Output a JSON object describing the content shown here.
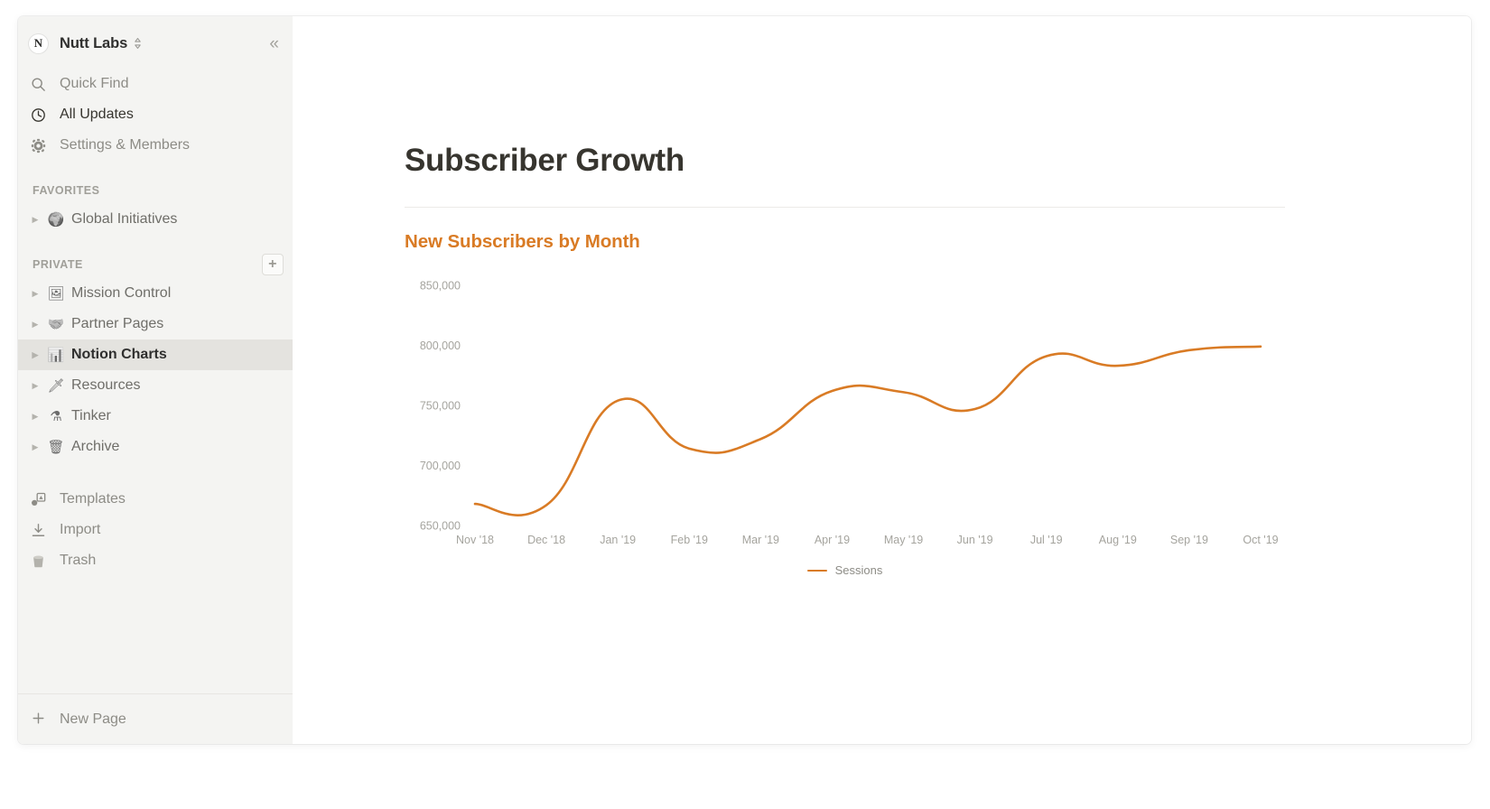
{
  "sidebar": {
    "workspace": {
      "initial": "N",
      "name": "Nutt Labs",
      "switcher_icon": "chevron-updown-icon",
      "collapse_icon": "«"
    },
    "nav_top": [
      {
        "label": "Quick Find",
        "icon": "search-icon",
        "emphasis": "muted"
      },
      {
        "label": "All Updates",
        "icon": "clock-icon",
        "emphasis": "dark"
      },
      {
        "label": "Settings & Members",
        "icon": "gear-icon",
        "emphasis": "muted"
      }
    ],
    "favorites": {
      "heading": "FAVORITES",
      "items": [
        {
          "label": "Global Initiatives",
          "emoji": "🌍",
          "selected": false
        }
      ]
    },
    "private": {
      "heading": "PRIVATE",
      "add_icon": "plus-icon",
      "items": [
        {
          "label": "Mission Control",
          "emoji": "🖼",
          "selected": false
        },
        {
          "label": "Partner Pages",
          "emoji": "🤝",
          "selected": false
        },
        {
          "label": "Notion Charts",
          "emoji": "📊",
          "selected": true
        },
        {
          "label": "Resources",
          "emoji": "🗡",
          "selected": false
        },
        {
          "label": "Tinker",
          "emoji": "⚗",
          "selected": false
        },
        {
          "label": "Archive",
          "emoji": "🗑",
          "selected": false
        }
      ]
    },
    "utilities": [
      {
        "label": "Templates",
        "icon": "templates-icon"
      },
      {
        "label": "Import",
        "icon": "import-icon"
      },
      {
        "label": "Trash",
        "icon": "trash-icon"
      }
    ],
    "footer": {
      "label": "New Page",
      "icon": "plus-icon"
    }
  },
  "page": {
    "title": "Subscriber Growth"
  },
  "colors": {
    "accent": "#d97b25",
    "title": "#37352f",
    "sidebar_bg": "#f4f4f2",
    "selected_bg": "#e4e3df",
    "tick": "#a5a49e"
  },
  "chart_data": {
    "type": "line",
    "title": "New Subscribers by Month",
    "xlabel": "",
    "ylabel": "",
    "grid": false,
    "legend_position": "bottom",
    "ylim": [
      650000,
      850000
    ],
    "yticks": [
      650000,
      700000,
      750000,
      800000,
      850000
    ],
    "ytick_labels": [
      "650,000",
      "700,000",
      "750,000",
      "800,000",
      "850,000"
    ],
    "categories": [
      "Nov '18",
      "Dec '18",
      "Jan '19",
      "Feb '19",
      "Mar '19",
      "Apr '19",
      "May '19",
      "Jun '19",
      "Jul '19",
      "Aug '19",
      "Sep '19",
      "Oct '19"
    ],
    "series": [
      {
        "name": "Sessions",
        "color": "#d97b25",
        "values": [
          668000,
          667000,
          754000,
          714000,
          722000,
          762000,
          761000,
          747000,
          791000,
          783000,
          796000,
          799000
        ]
      }
    ]
  }
}
